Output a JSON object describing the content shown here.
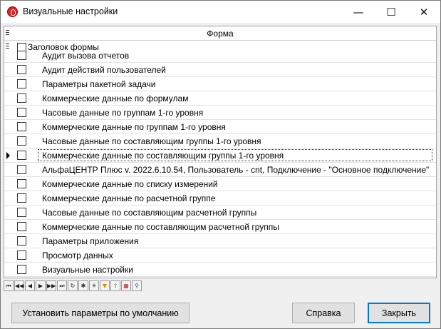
{
  "window": {
    "title": "Визуальные настройки",
    "controls": {
      "minimize": "—",
      "maximize": "☐",
      "close": "✕"
    }
  },
  "grid": {
    "column_header": "Форма",
    "group_label": "Заголовок формы",
    "rows": [
      "Аудит вызова отчетов",
      "Аудит действий пользователей",
      "Параметры пакетной задачи",
      "Коммерческие данные по формулам",
      "Часовые данные по группам 1-го уровня",
      "Коммерческие данные по группам 1-го уровня",
      "Часовые данные по составляющим группы 1-го уровня",
      "Коммерческие данные по составляющим группы 1-го уровня",
      "АльфаЦЕНТР Плюс v. 2022.6.10.54, Пользователь - cnt, Подключение - \"Основное подключение\"",
      "Коммерческие данные по списку измерений",
      "Коммерческие данные по расчетной группе",
      "Часовые данные по составляющим расчетной группы",
      "Коммерческие данные по составляющим расчетной группы",
      "Параметры приложения",
      "Просмотр данных",
      "Визуальные настройки"
    ],
    "current_row_index": 7
  },
  "navigator": {
    "buttons": [
      {
        "name": "first-page",
        "glyph": "⏮"
      },
      {
        "name": "prior-page",
        "glyph": "◀◀"
      },
      {
        "name": "prior",
        "glyph": "◀"
      },
      {
        "name": "next",
        "glyph": "▶"
      },
      {
        "name": "next-page",
        "glyph": "▶▶"
      },
      {
        "name": "last-page",
        "glyph": "⏭"
      },
      {
        "name": "refresh",
        "glyph": "↻"
      },
      {
        "name": "expand-all",
        "glyph": "✱"
      },
      {
        "name": "collapse-all",
        "glyph": "✳"
      },
      {
        "name": "filter",
        "glyph": "▼"
      },
      {
        "name": "export",
        "glyph": "⇪"
      },
      {
        "name": "grid-settings",
        "glyph": "▦"
      },
      {
        "name": "find",
        "glyph": "⚲"
      }
    ]
  },
  "footer": {
    "defaults_label": "Установить параметры по умолчанию",
    "help_label": "Справка",
    "close_label": "Закрыть"
  }
}
